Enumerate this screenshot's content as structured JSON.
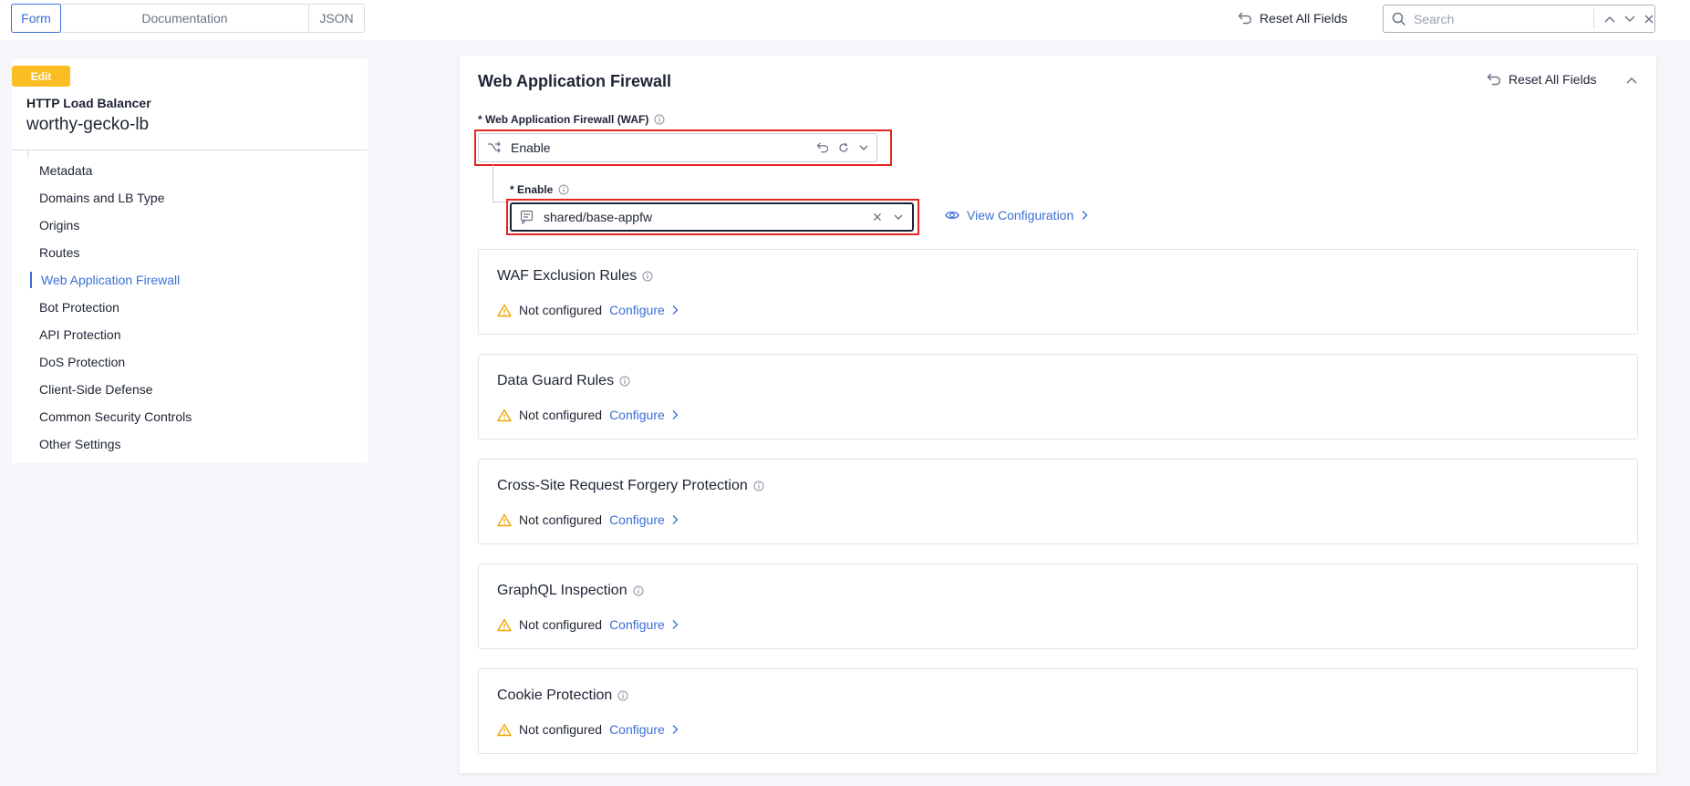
{
  "topbar": {
    "tabs": [
      {
        "label": "Form"
      },
      {
        "label": "Documentation"
      },
      {
        "label": "JSON"
      }
    ],
    "reset_label": "Reset All Fields",
    "search_placeholder": "Search"
  },
  "sidebar": {
    "badge": "Edit",
    "object_type": "HTTP Load Balancer",
    "object_name": "worthy-gecko-lb",
    "items": [
      {
        "label": "Metadata"
      },
      {
        "label": "Domains and LB Type"
      },
      {
        "label": "Origins"
      },
      {
        "label": "Routes"
      },
      {
        "label": "Web Application Firewall",
        "active": true
      },
      {
        "label": "Bot Protection"
      },
      {
        "label": "API Protection"
      },
      {
        "label": "DoS Protection"
      },
      {
        "label": "Client-Side Defense"
      },
      {
        "label": "Common Security Controls"
      },
      {
        "label": "Other Settings"
      }
    ]
  },
  "main": {
    "title": "Web Application Firewall",
    "reset_label": "Reset All Fields",
    "waf_field": {
      "label": "* Web Application Firewall (WAF)",
      "value": "Enable"
    },
    "enable_field": {
      "label": "* Enable",
      "value": "shared/base-appfw"
    },
    "view_config_label": "View Configuration",
    "sections": [
      {
        "title": "WAF Exclusion Rules",
        "status": "Not configured",
        "action": "Configure"
      },
      {
        "title": "Data Guard Rules",
        "status": "Not configured",
        "action": "Configure"
      },
      {
        "title": "Cross-Site Request Forgery Protection",
        "status": "Not configured",
        "action": "Configure"
      },
      {
        "title": "GraphQL Inspection",
        "status": "Not configured",
        "action": "Configure"
      },
      {
        "title": "Cookie Protection",
        "status": "Not configured",
        "action": "Configure"
      }
    ]
  },
  "colors": {
    "accent": "#3b6fd6",
    "badge": "#fbbd24",
    "highlight_box": "#e3271f",
    "warning": "#f0a500"
  }
}
